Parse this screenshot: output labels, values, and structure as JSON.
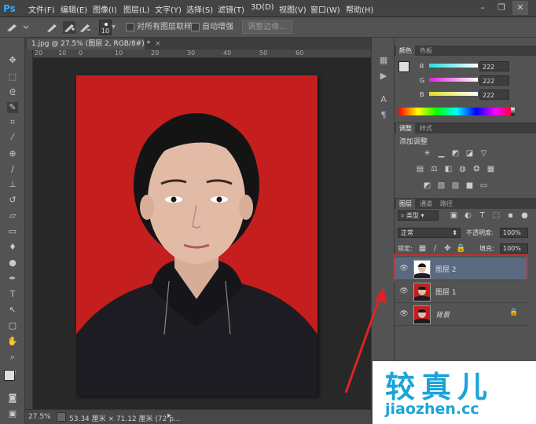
{
  "app": {
    "logo": "Ps"
  },
  "menus": [
    "文件(F)",
    "编辑(E)",
    "图像(I)",
    "图层(L)",
    "文字(Y)",
    "选择(S)",
    "滤镜(T)",
    "3D(D)",
    "视图(V)",
    "窗口(W)",
    "帮助(H)"
  ],
  "window_controls": {
    "minimize": "–",
    "restore": "❐",
    "close": "✕"
  },
  "options": {
    "brush_size": "10",
    "sample_all_layers_label": "对所有图层取样",
    "auto_enhance_label": "自动增强",
    "refine_edge_label": "调整边缘..."
  },
  "document": {
    "tab_title": "1.jpg @ 27.5% (图层 2, RGB/8#) *",
    "tab_close": "×",
    "ruler_ticks": [
      "20",
      "10",
      "0",
      "10",
      "20",
      "30",
      "40",
      "50",
      "60"
    ],
    "zoom": "27.5%",
    "doc_info": "53.34 厘米 × 71.12 厘米 (72 p..."
  },
  "color_panel": {
    "tabs": [
      "颜色",
      "色板"
    ],
    "channels": [
      {
        "label": "R",
        "value": "222",
        "gradient": "#21dede"
      },
      {
        "label": "G",
        "value": "222",
        "gradient": "#de21de"
      },
      {
        "label": "B",
        "value": "222",
        "gradient": "#dede21"
      }
    ]
  },
  "adjustments_panel": {
    "tabs": [
      "调整",
      "样式"
    ],
    "title": "添加调整"
  },
  "layers_panel": {
    "tabs": [
      "图层",
      "通道",
      "路径"
    ],
    "filter_kind": "类型",
    "blend_mode": "正常",
    "opacity_label": "不透明度:",
    "opacity_value": "100%",
    "lock_label": "锁定:",
    "fill_label": "填充:",
    "fill_value": "100%",
    "layers": [
      {
        "name": "图层 2",
        "selected": true
      },
      {
        "name": "图层 1",
        "selected": false
      },
      {
        "name": "背景",
        "selected": false,
        "locked": true
      }
    ]
  },
  "watermark": {
    "cn": "较真儿",
    "en": "jiaozhen.cc"
  },
  "colors": {
    "accent": "#31a8ff",
    "photo_bg": "#c41e1e",
    "highlight": "#e02222",
    "watermark": "#1ba3d8"
  }
}
